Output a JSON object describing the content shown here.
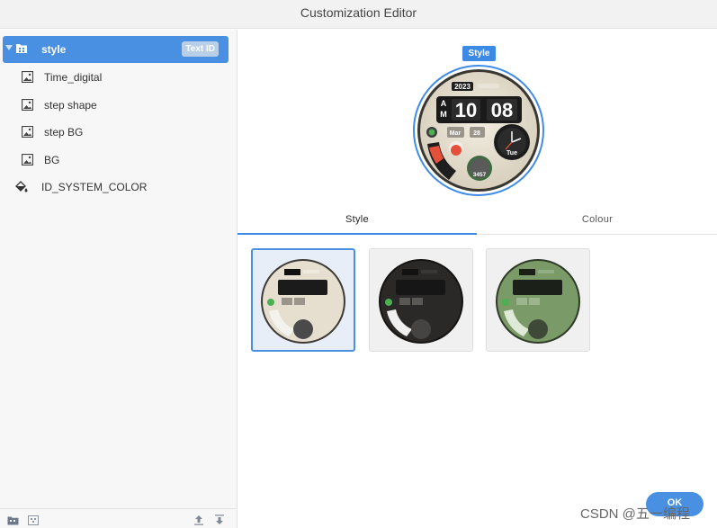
{
  "window": {
    "title": "Customization Editor"
  },
  "tree": {
    "root": {
      "label": "style",
      "badge": "Text ID"
    },
    "children": [
      {
        "label": "Time_digital"
      },
      {
        "label": "step shape"
      },
      {
        "label": "step BG"
      },
      {
        "label": "BG"
      }
    ],
    "system_color": {
      "label": "ID_SYSTEM_COLOR"
    }
  },
  "preview": {
    "tag": "Style",
    "watch": {
      "year": "2023",
      "am": "A",
      "pm_m": "M",
      "hours": "10",
      "minutes": "08",
      "month": "Mar",
      "day": "28",
      "weekday": "Tue",
      "steps": "3457"
    }
  },
  "tabs": [
    {
      "label": "Style"
    },
    {
      "label": "Colour"
    }
  ],
  "thumbnails": [
    {
      "variant": "cream",
      "face": "#e6dfcf",
      "accent": "#111111"
    },
    {
      "variant": "dark",
      "face": "#2b2927",
      "accent": "#5a5855"
    },
    {
      "variant": "green",
      "face": "#7a9a68",
      "accent": "#2f3a2a"
    }
  ],
  "footer": {
    "ok_label": "OK"
  },
  "watermark": "CSDN @五一编程",
  "colors": {
    "accent": "#4a90e2",
    "selected_row": "#4a90e2"
  }
}
